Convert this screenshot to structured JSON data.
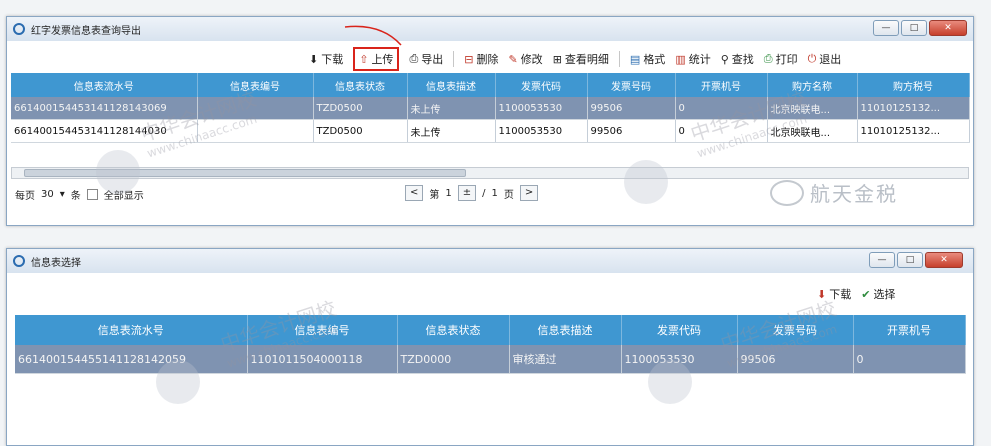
{
  "window1": {
    "title": "红字发票信息表查询导出",
    "toolbar": [
      {
        "icon": "download-icon",
        "glyph": "⬇",
        "label": "下载"
      },
      {
        "icon": "upload-icon",
        "glyph": "⇧",
        "label": "上传"
      },
      {
        "icon": "export-icon",
        "glyph": "⎙",
        "label": "导出"
      },
      {
        "icon": "delete-icon",
        "glyph": "⊟",
        "label": "删除"
      },
      {
        "icon": "edit-icon",
        "glyph": "✎",
        "label": "修改"
      },
      {
        "icon": "view-details-icon",
        "glyph": "⊞",
        "label": "查看明细"
      },
      {
        "icon": "format-icon",
        "glyph": "▤",
        "label": "格式"
      },
      {
        "icon": "statistics-icon",
        "glyph": "▥",
        "label": "统计"
      },
      {
        "icon": "search-icon",
        "glyph": "⚲",
        "label": "查找"
      },
      {
        "icon": "print-icon",
        "glyph": "⎙",
        "label": "打印"
      },
      {
        "icon": "exit-icon",
        "glyph": "⏻",
        "label": "退出"
      }
    ],
    "columns": [
      "信息表流水号",
      "信息表编号",
      "信息表状态",
      "信息表描述",
      "发票代码",
      "发票号码",
      "开票机号",
      "购方名称",
      "购方税号"
    ],
    "rows": [
      [
        "661400154453141128143069",
        "",
        "TZD0500",
        "未上传",
        "1100053530",
        "99506",
        "0",
        "北京映联电...",
        "11010125132..."
      ],
      [
        "661400154453141128144030",
        "",
        "TZD0500",
        "未上传",
        "1100053530",
        "99506",
        "0",
        "北京映联电...",
        "11010125132..."
      ]
    ],
    "pager": {
      "per_page_label": "每页",
      "per_page_value": "30",
      "unit": "条",
      "show_all": "全部显示",
      "prev": "<",
      "page_prefix": "第",
      "page_current": "1",
      "page_sep": "/",
      "page_total": "1",
      "page_suffix": "页",
      "next": ">"
    }
  },
  "window2": {
    "title": "信息表选择",
    "toolbar": [
      {
        "icon": "download-icon",
        "glyph": "⬇",
        "label": "下载"
      },
      {
        "icon": "select-icon",
        "glyph": "✔",
        "label": "选择"
      }
    ],
    "columns": [
      "信息表流水号",
      "信息表编号",
      "信息表状态",
      "信息表描述",
      "发票代码",
      "发票号码",
      "开票机号"
    ],
    "rows": [
      [
        "661400154455141128142059",
        "1101011504000118",
        "TZD0000",
        "审核通过",
        "1100053530",
        "99506",
        "0"
      ]
    ]
  },
  "watermark": {
    "cn": "中华会计网校",
    "url": "www.chinaacc.com"
  },
  "brand": "航天金税"
}
